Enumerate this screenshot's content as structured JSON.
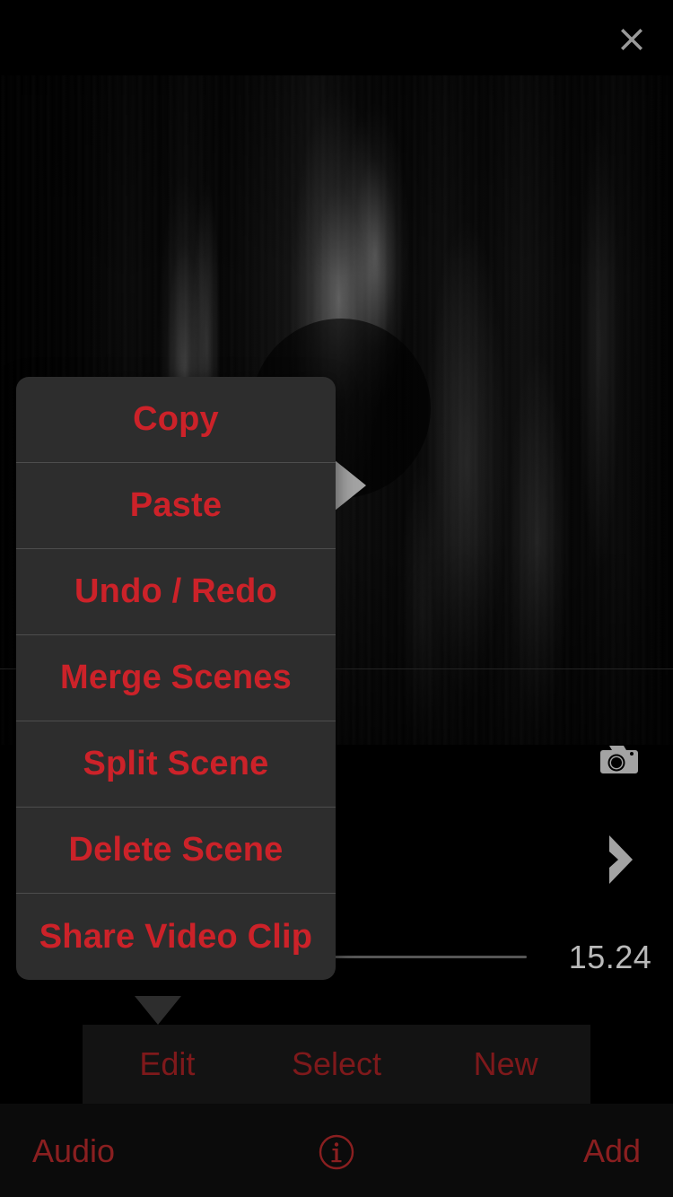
{
  "topbar": {
    "close_icon": "close-icon",
    "close_color": "#999999"
  },
  "video": {
    "play_icon": "play-icon",
    "play_color": "#a3a3a3",
    "description": "dark motion-blurred vertical light streaks video frame"
  },
  "controls": {
    "camera_icon": "camera-icon",
    "next_scene_icon": "chevron-right-icon",
    "icon_color": "#a3a3a3",
    "timecode": "15.24",
    "timecode_color": "#b9b9b9",
    "track_color": "#565656"
  },
  "mode_strip": {
    "items": [
      {
        "label": "Edit"
      },
      {
        "label": "Select"
      },
      {
        "label": "New"
      }
    ],
    "color": "#7e191b",
    "background": "#131313"
  },
  "bottombar": {
    "audio_label": "Audio",
    "add_label": "Add",
    "info_icon": "info-icon",
    "color": "#8a1f20"
  },
  "menu": {
    "accent_color": "#cc2229",
    "background": "#2d2d2d",
    "separator_color": "#4d4d4d",
    "items": [
      {
        "label": "Copy"
      },
      {
        "label": "Paste"
      },
      {
        "label": "Undo / Redo"
      },
      {
        "label": "Merge Scenes"
      },
      {
        "label": "Split Scene"
      },
      {
        "label": "Delete Scene"
      },
      {
        "label": "Share Video Clip"
      }
    ]
  }
}
